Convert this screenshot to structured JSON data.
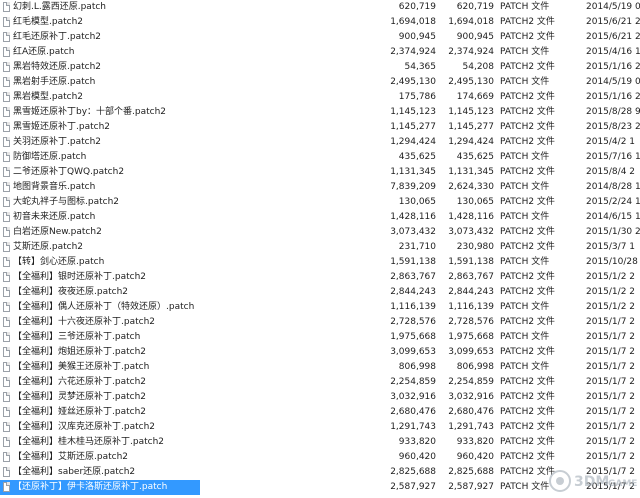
{
  "rows": [
    {
      "name": "幻刺.L.露西还原.patch",
      "size": "620,719",
      "packed": "620,719",
      "type": "PATCH 文件",
      "date": "2014/5/19 0"
    },
    {
      "name": "红毛模型.patch2",
      "size": "1,694,018",
      "packed": "1,694,018",
      "type": "PATCH2 文件",
      "date": "2015/6/21 2"
    },
    {
      "name": "红毛还原补丁.patch2",
      "size": "900,945",
      "packed": "900,945",
      "type": "PATCH2 文件",
      "date": "2015/6/21 2"
    },
    {
      "name": "红A还原.patch",
      "size": "2,374,924",
      "packed": "2,374,924",
      "type": "PATCH 文件",
      "date": "2015/4/16 1"
    },
    {
      "name": "黑岩特效还原.patch2",
      "size": "54,365",
      "packed": "54,208",
      "type": "PATCH2 文件",
      "date": "2015/1/16 2"
    },
    {
      "name": "黑岩射手还原.patch",
      "size": "2,495,130",
      "packed": "2,495,130",
      "type": "PATCH 文件",
      "date": "2014/5/19 0"
    },
    {
      "name": "黑岩模型.patch2",
      "size": "175,786",
      "packed": "174,669",
      "type": "PATCH2 文件",
      "date": "2015/1/16 2"
    },
    {
      "name": "黑雪姬还原补丁by：十部个番.patch2",
      "size": "1,145,123",
      "packed": "1,145,123",
      "type": "PATCH2 文件",
      "date": "2015/8/28 9"
    },
    {
      "name": "黑雪姬还原补丁.patch2",
      "size": "1,145,277",
      "packed": "1,145,277",
      "type": "PATCH2 文件",
      "date": "2015/8/23 2"
    },
    {
      "name": "关羽还原补丁.patch2",
      "size": "1,294,424",
      "packed": "1,294,424",
      "type": "PATCH2 文件",
      "date": "2015/4/2 1"
    },
    {
      "name": "防御塔还原.patch",
      "size": "435,625",
      "packed": "435,625",
      "type": "PATCH 文件",
      "date": "2015/7/16 1"
    },
    {
      "name": "二爷还原补丁QWQ.patch2",
      "size": "1,131,345",
      "packed": "1,131,345",
      "type": "PATCH2 文件",
      "date": "2015/8/4 2"
    },
    {
      "name": "地图背景音乐.patch",
      "size": "7,839,209",
      "packed": "2,624,330",
      "type": "PATCH 文件",
      "date": "2014/8/28 1"
    },
    {
      "name": "大蛇丸袢子与图标.patch2",
      "size": "130,065",
      "packed": "130,065",
      "type": "PATCH2 文件",
      "date": "2015/2/24 1"
    },
    {
      "name": "初音未来还原.patch",
      "size": "1,428,116",
      "packed": "1,428,116",
      "type": "PATCH 文件",
      "date": "2014/6/15 1"
    },
    {
      "name": "白岩还原New.patch2",
      "size": "3,073,432",
      "packed": "3,073,432",
      "type": "PATCH2 文件",
      "date": "2015/1/30 2"
    },
    {
      "name": "艾斯还原.patch2",
      "size": "231,710",
      "packed": "230,980",
      "type": "PATCH2 文件",
      "date": "2015/3/7 1"
    },
    {
      "name": "【转】剑心还原.patch",
      "size": "1,591,138",
      "packed": "1,591,138",
      "type": "PATCH 文件",
      "date": "2015/10/28"
    },
    {
      "name": "【全福利】银时还原补丁.patch2",
      "size": "2,863,767",
      "packed": "2,863,767",
      "type": "PATCH2 文件",
      "date": "2015/1/2 2"
    },
    {
      "name": "【全福利】夜夜还原.patch2",
      "size": "2,844,243",
      "packed": "2,844,243",
      "type": "PATCH2 文件",
      "date": "2015/1/2 2"
    },
    {
      "name": "【全福利】偶人还原补丁（特效还原）.patch",
      "size": "1,116,139",
      "packed": "1,116,139",
      "type": "PATCH 文件",
      "date": "2015/1/2 2"
    },
    {
      "name": "【全福利】十六夜还原补丁.patch2",
      "size": "2,728,576",
      "packed": "2,728,576",
      "type": "PATCH2 文件",
      "date": "2015/1/7 2"
    },
    {
      "name": "【全福利】三爷还原补丁.patch",
      "size": "1,975,668",
      "packed": "1,975,668",
      "type": "PATCH 文件",
      "date": "2015/1/7 2"
    },
    {
      "name": "【全福利】炮姐还原补丁.patch2",
      "size": "3,099,653",
      "packed": "3,099,653",
      "type": "PATCH2 文件",
      "date": "2015/1/7 2"
    },
    {
      "name": "【全福利】美猴王还原补丁.patch",
      "size": "806,998",
      "packed": "806,998",
      "type": "PATCH 文件",
      "date": "2015/1/7 2"
    },
    {
      "name": "【全福利】六花还原补丁.patch2",
      "size": "2,254,859",
      "packed": "2,254,859",
      "type": "PATCH2 文件",
      "date": "2015/1/7 2"
    },
    {
      "name": "【全福利】灵梦还原补丁.patch2",
      "size": "3,032,916",
      "packed": "3,032,916",
      "type": "PATCH2 文件",
      "date": "2015/1/7 2"
    },
    {
      "name": "【全福利】娅丝还原补丁.patch2",
      "size": "2,680,476",
      "packed": "2,680,476",
      "type": "PATCH2 文件",
      "date": "2015/1/7 2"
    },
    {
      "name": "【全福利】汉库克还原补丁.patch2",
      "size": "1,291,743",
      "packed": "1,291,743",
      "type": "PATCH2 文件",
      "date": "2015/1/7 2"
    },
    {
      "name": "【全福利】桂木桂马还原补丁.patch2",
      "size": "933,820",
      "packed": "933,820",
      "type": "PATCH2 文件",
      "date": "2015/1/7 2"
    },
    {
      "name": "【全福利】艾斯还原.patch2",
      "size": "960,420",
      "packed": "960,420",
      "type": "PATCH2 文件",
      "date": "2015/1/7 2"
    },
    {
      "name": "【全福利】saber还原.patch2",
      "size": "2,825,688",
      "packed": "2,825,688",
      "type": "PATCH2 文件",
      "date": "2015/1/7 2"
    },
    {
      "name": "【还原补丁】伊卡洛斯还原补丁.patch",
      "size": "2,587,927",
      "packed": "2,587,927",
      "type": "PATCH 文件",
      "date": "2015/1/7 2",
      "selected": true
    }
  ],
  "watermark": {
    "brand": "3DM",
    "suffix": "GAME"
  },
  "colors": {
    "selection": "#3399ff",
    "text": "#1e1e1e"
  }
}
